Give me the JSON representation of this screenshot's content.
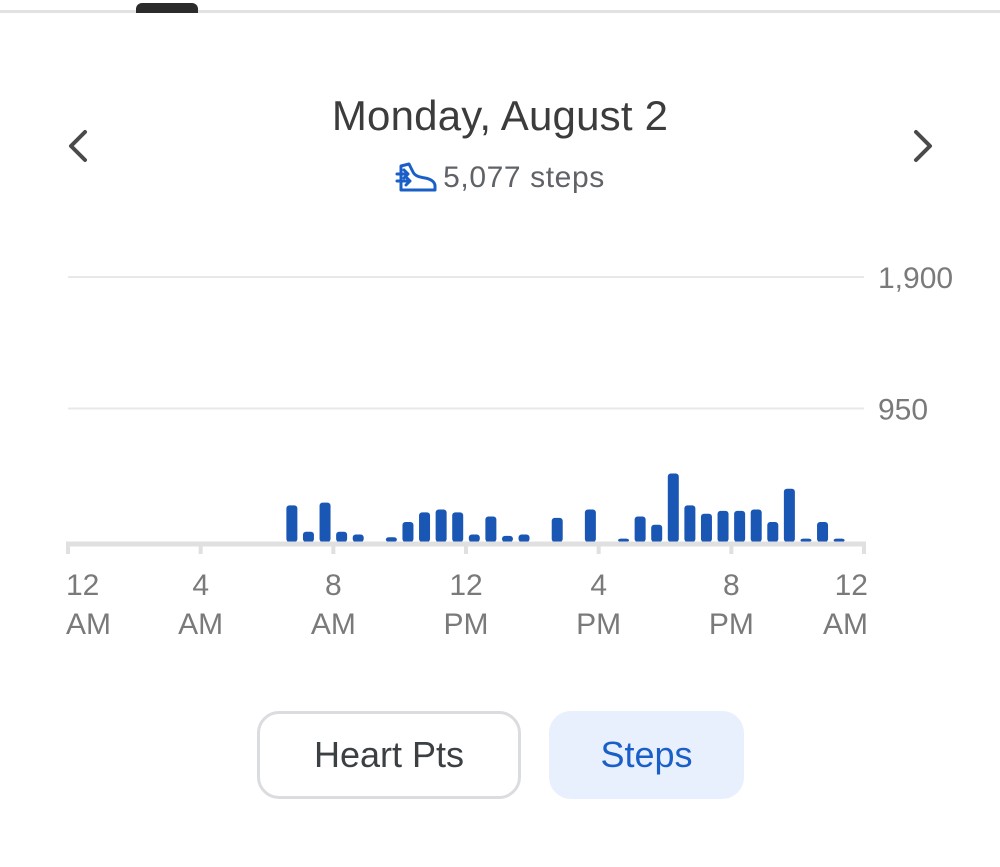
{
  "header": {
    "date": "Monday, August 2",
    "steps_total": "5,077 steps",
    "prev_label": "Previous day",
    "next_label": "Next day"
  },
  "colors": {
    "bar": "#1a56b4",
    "accent": "#1a5fc7",
    "selected_bg": "#e8f0fe",
    "grid": "#e8e8e8",
    "axis": "#e0e0e0",
    "tick_text": "#7a7a7a"
  },
  "chart_data": {
    "type": "bar",
    "y_ticks": [
      {
        "value": 1900,
        "label": "1,900"
      },
      {
        "value": 950,
        "label": "950"
      }
    ],
    "x_ticks": [
      {
        "hour": 0,
        "line1": "12",
        "line2": "AM"
      },
      {
        "hour": 4,
        "line1": "4",
        "line2": "AM"
      },
      {
        "hour": 8,
        "line1": "8",
        "line2": "AM"
      },
      {
        "hour": 12,
        "line1": "12",
        "line2": "PM"
      },
      {
        "hour": 16,
        "line1": "4",
        "line2": "PM"
      },
      {
        "hour": 20,
        "line1": "8",
        "line2": "PM"
      },
      {
        "hour": 24,
        "line1": "12",
        "line2": "AM"
      }
    ],
    "ylim": [
      0,
      1900
    ],
    "bucket_minutes": 30,
    "x": [
      6.75,
      7.25,
      7.75,
      8.25,
      8.75,
      9.75,
      10.25,
      10.75,
      11.25,
      11.75,
      12.25,
      12.75,
      13.25,
      13.75,
      14.75,
      15.75,
      16.75,
      17.25,
      17.75,
      18.25,
      18.75,
      19.25,
      19.75,
      20.25,
      20.75,
      21.25,
      21.75,
      22.25,
      22.75,
      23.25
    ],
    "values": [
      250,
      60,
      270,
      60,
      40,
      20,
      130,
      200,
      220,
      200,
      40,
      170,
      30,
      40,
      160,
      220,
      10,
      170,
      110,
      480,
      250,
      190,
      210,
      210,
      220,
      130,
      370,
      10,
      130,
      10
    ],
    "grid": true
  },
  "tabs": {
    "heart_pts": "Heart Pts",
    "steps": "Steps",
    "selected": "steps"
  }
}
